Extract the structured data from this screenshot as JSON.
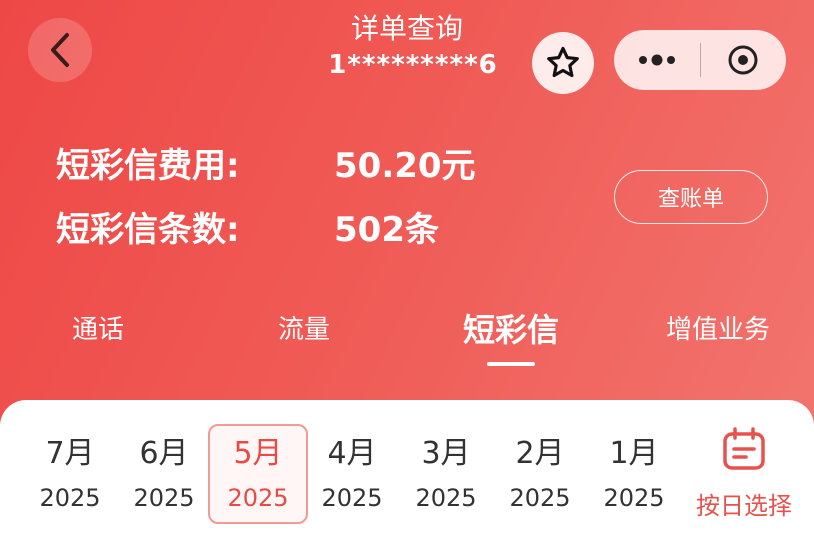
{
  "nav": {
    "title": "详单查询",
    "phone_masked": "1*********6"
  },
  "summary": {
    "fee_label": "短彩信费用:",
    "fee_value": "50.20元",
    "count_label": "短彩信条数:",
    "count_value": "502条",
    "bill_button": "查账单"
  },
  "tabs": [
    {
      "label": "通话"
    },
    {
      "label": "流量"
    },
    {
      "label": "短彩信"
    },
    {
      "label": "增值业务"
    }
  ],
  "active_tab": "短彩信",
  "months": [
    {
      "month": "7月",
      "year": "2025"
    },
    {
      "month": "6月",
      "year": "2025"
    },
    {
      "month": "5月",
      "year": "2025"
    },
    {
      "month": "4月",
      "year": "2025"
    },
    {
      "month": "3月",
      "year": "2025"
    },
    {
      "month": "2月",
      "year": "2025"
    },
    {
      "month": "1月",
      "year": "2025"
    }
  ],
  "selected_month": "5月",
  "date_picker_label": "按日选择",
  "icons": {
    "back": "chevron-left-icon",
    "favorite": "star-icon",
    "more": "more-dots-icon",
    "close": "target-circle-icon",
    "calendar": "calendar-icon"
  },
  "colors": {
    "header_gradient_start": "#ee4846",
    "header_gradient_end": "#f27670",
    "accent": "#e64b46",
    "panel_bg": "#ffffff"
  }
}
